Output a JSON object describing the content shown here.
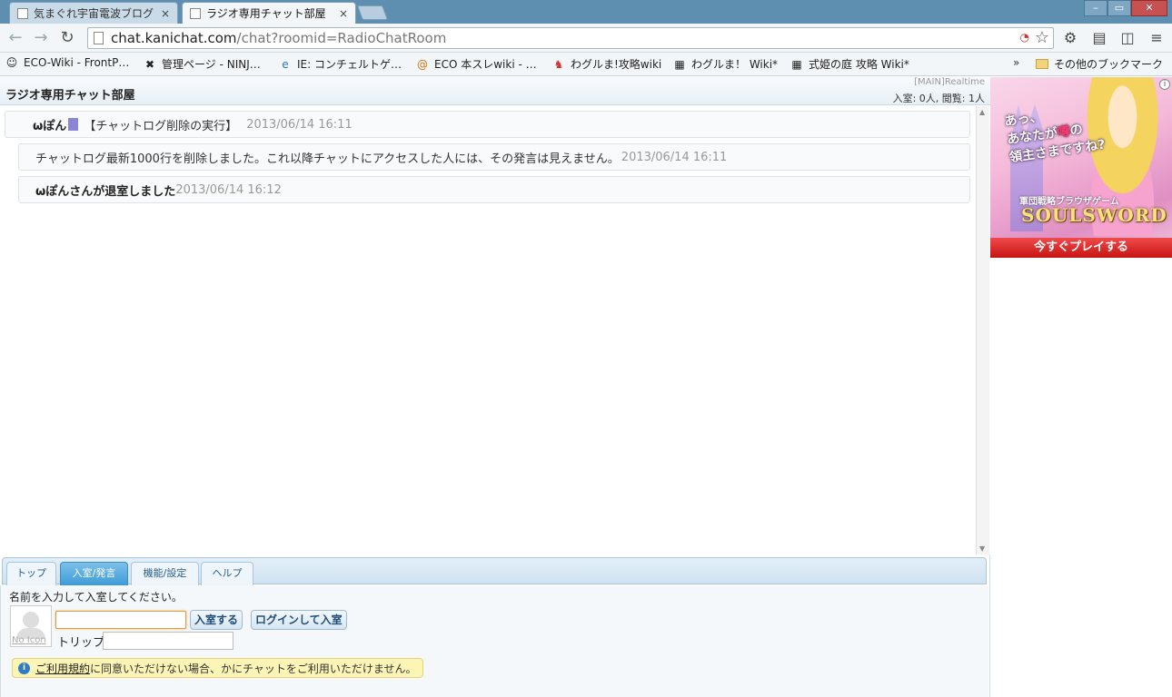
{
  "browser": {
    "tabs": [
      {
        "title": "気まぐれ宇宙電波ブログ",
        "icon": "page-icon"
      },
      {
        "title": "ラジオ専用チャット部屋",
        "icon": "page-icon"
      }
    ],
    "close_glyph": "×",
    "window_controls": {
      "minimize": "–",
      "maximize": "▭",
      "close": "✕"
    },
    "url_host": "chat.kanichat.com",
    "url_path": "/chat?roomid=RadioChatRoom",
    "bookmarks": [
      "ECO-Wiki - FrontP…",
      "管理ページ - NINJ…",
      "IE: コンチェルトゲ…",
      "ECO 本スレwiki - …",
      "わグルま!攻略wiki",
      "わグルま！ Wiki*",
      "式姫の庭 攻略 Wiki*"
    ],
    "more_glyph": "»",
    "other_bookmarks": "その他のブックマーク"
  },
  "room": {
    "title": "ラジオ専用チャット部屋",
    "mode": "[MAIN]Realtime",
    "stats": "入室: 0人, 閲覧: 1人"
  },
  "messages": [
    {
      "user": "ωぽん",
      "text": "【チャットログ削除の実行】",
      "time": "2013/06/14 16:11",
      "color": "#8b85d6"
    },
    {
      "text": "チャットログ最新1000行を削除しました。これ以降チャットにアクセスした人には、その発言は見えません。",
      "time": "2013/06/14 16:11"
    },
    {
      "text": "ωぽんさんが退室しました",
      "time": "2013/06/14 16:12"
    }
  ],
  "panel": {
    "tabs": [
      "トップ",
      "入室/発言",
      "機能/設定",
      "ヘルプ"
    ],
    "active_tab": 1,
    "prompt": "名前を入力して入室してください。",
    "no_icon_label": "No Icon",
    "name_value": "",
    "enter_button": "入室する",
    "login_button": "ログインして入室",
    "trip_label": "トリップ",
    "trip_value": "",
    "notice_link": "ご利用規約",
    "notice_text": "に同意いただけない場合、かにチャットをご利用いただけません。",
    "info_glyph": "i"
  },
  "ad": {
    "copy_line1": "あっ、",
    "copy_line2_a": "あなたが",
    "copy_line2_b": "噂",
    "copy_line2_c": "の",
    "copy_line3": "領主さまですね?",
    "genre": "軍団戦略ブラウザゲーム",
    "logo": "SOULSWORD",
    "cta": "今すぐプレイする",
    "info_glyph": "i"
  }
}
